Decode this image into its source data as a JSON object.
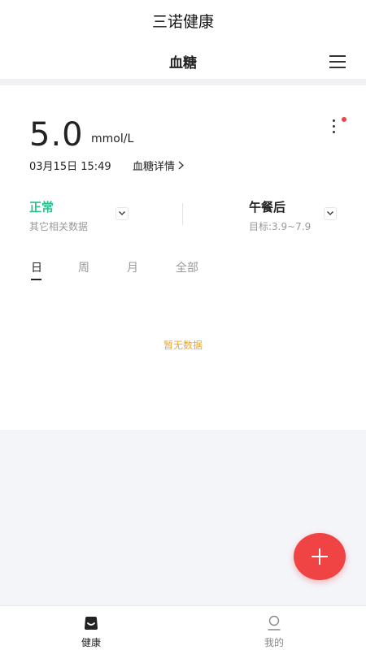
{
  "app": {
    "title": "三诺健康"
  },
  "header": {
    "page_title": "血糖",
    "menu_icon": "hamburger-icon"
  },
  "reading": {
    "value": "5.0",
    "unit": "mmol/L",
    "datetime": "03月15日  15:49",
    "detail_link": "血糖详情",
    "notification_color": "#f04343"
  },
  "status": {
    "label": "正常",
    "sub": "其它相关数据",
    "color": "#2dbf8c"
  },
  "period": {
    "label": "午餐后",
    "sub": "目标:3.9~7.9"
  },
  "tabs": [
    {
      "label": "日",
      "active": true
    },
    {
      "label": "周",
      "active": false
    },
    {
      "label": "月",
      "active": false
    },
    {
      "label": "全部",
      "active": false
    }
  ],
  "empty_state": {
    "text": "暂无数据",
    "color": "#f5a623"
  },
  "fab": {
    "icon": "plus-icon",
    "color": "#f04343"
  },
  "bottom_nav": [
    {
      "label": "健康",
      "icon": "health-icon",
      "active": true
    },
    {
      "label": "我的",
      "icon": "profile-icon",
      "active": false
    }
  ]
}
